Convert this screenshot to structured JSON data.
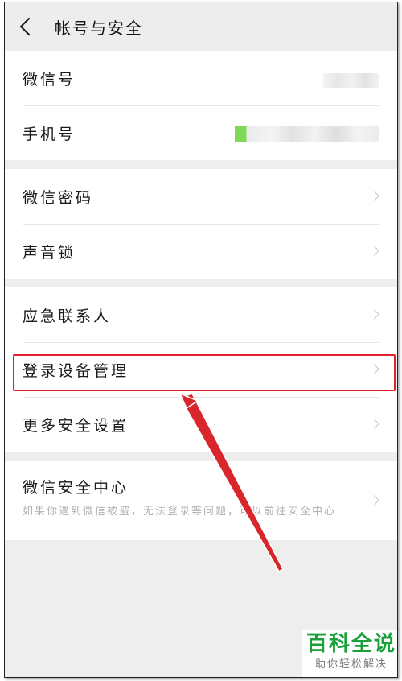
{
  "header": {
    "title": "帐号与安全"
  },
  "group1": {
    "items": [
      {
        "label": "微信号"
      },
      {
        "label": "手机号"
      }
    ]
  },
  "group2": {
    "items": [
      {
        "label": "微信密码"
      },
      {
        "label": "声音锁"
      }
    ]
  },
  "group3": {
    "items": [
      {
        "label": "应急联系人"
      },
      {
        "label": "登录设备管理"
      },
      {
        "label": "更多安全设置"
      }
    ]
  },
  "group4": {
    "title": "微信安全中心",
    "description": "如果你遇到微信被盗，无法登录等问题，可以前往安全中心"
  },
  "watermark": {
    "main": "百科全说",
    "sub": "助你轻松解决"
  },
  "colors": {
    "highlight": "#e0202a",
    "watermark": "#1aa038",
    "phone_blur_accent": "#7ed957"
  }
}
